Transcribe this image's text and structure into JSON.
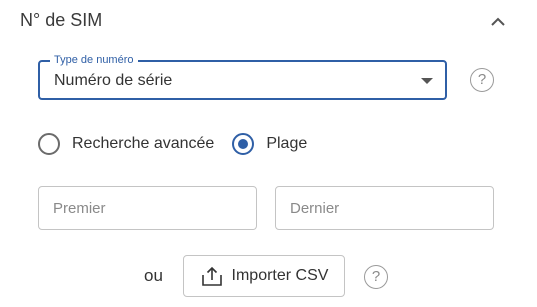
{
  "section": {
    "title": "N° de SIM",
    "collapse_icon": "chevron-up-icon"
  },
  "number_type": {
    "label": "Type de numéro",
    "selected_value": "Numéro de série",
    "help_icon": "question-mark-icon",
    "help_glyph": "?"
  },
  "search_mode": {
    "options": [
      {
        "label": "Recherche avancée",
        "checked": false
      },
      {
        "label": "Plage",
        "checked": true
      }
    ]
  },
  "range": {
    "first_placeholder": "Premier",
    "last_placeholder": "Dernier"
  },
  "import": {
    "or_text": "ou",
    "button_label": "Importer CSV",
    "button_icon": "upload-icon",
    "help_icon": "question-mark-icon",
    "help_glyph": "?"
  },
  "colors": {
    "accent": "#2f5fa6",
    "border": "#c4c4c4",
    "text": "#333333",
    "muted": "#8a8a8a"
  }
}
